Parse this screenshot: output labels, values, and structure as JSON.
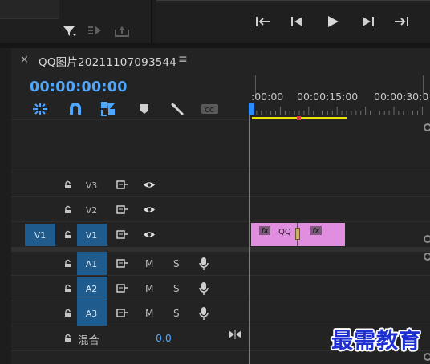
{
  "tab": {
    "title": "QQ图片20211107093544",
    "close": "×",
    "menu": "≡"
  },
  "timecode": "00:00:00:00",
  "tools": [
    {
      "name": "snap-icon",
      "kind": "snap"
    },
    {
      "name": "magnet-icon",
      "kind": "magnet"
    },
    {
      "name": "linked-selection-icon",
      "kind": "linked"
    },
    {
      "name": "marker-icon",
      "kind": "marker"
    },
    {
      "name": "wrench-icon",
      "kind": "wrench"
    },
    {
      "name": "captions-icon",
      "kind": "cc"
    }
  ],
  "ruler": {
    "labels": [
      ":00:00",
      "00:00:15:00",
      "00:00:30:0"
    ]
  },
  "tracks": {
    "video": [
      {
        "source": "",
        "label": "V3",
        "active": false
      },
      {
        "source": "",
        "label": "V2",
        "active": false
      },
      {
        "source": "V1",
        "label": "V1",
        "active": true
      }
    ],
    "audio": [
      {
        "label": "A1",
        "m": "M",
        "s": "S"
      },
      {
        "label": "A2",
        "m": "M",
        "s": "S"
      },
      {
        "label": "A3",
        "m": "M",
        "s": "S"
      }
    ],
    "mix": {
      "label": "混合",
      "value": "0.0"
    }
  },
  "clip": {
    "name": "QQ",
    "fx": "fx"
  },
  "watermark": "最需教育",
  "colors": {
    "accent": "#4fa6ff",
    "clip": "#e28ee0",
    "track_target": "#1f5b8c",
    "work_area": "#e7e400"
  }
}
